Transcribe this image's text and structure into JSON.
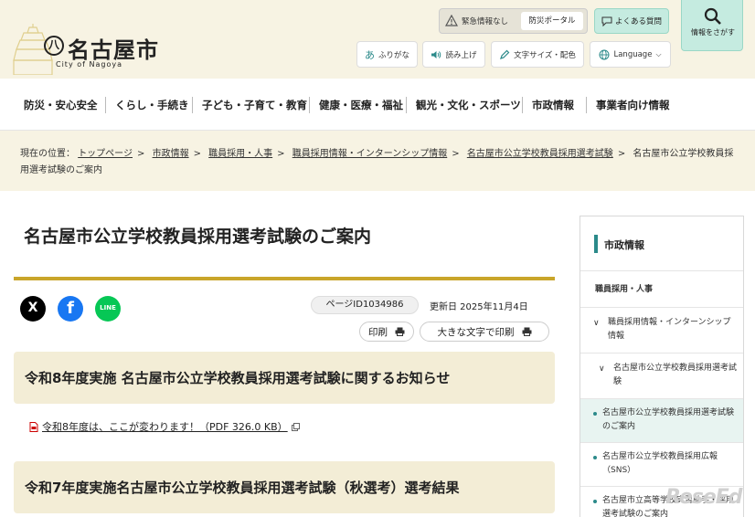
{
  "logo": {
    "title": "名古屋市",
    "subtitle": "City of Nagoya",
    "mark": "八"
  },
  "utility": {
    "emergency": "緊急情報なし",
    "portal": "防災ポータル",
    "faq": "よくある質問",
    "search": "情報をさがす",
    "furigana_icon": "あ",
    "furigana": "ふりがな",
    "readaloud": "読み上げ",
    "textsize": "文字サイズ・配色",
    "language": "Language"
  },
  "nav": [
    "防災・安心安全",
    "くらし・手続き",
    "子ども・子育て・教育",
    "健康・医療・福祉",
    "観光・文化・スポーツ",
    "市政情報",
    "事業者向け情報"
  ],
  "breadcrumb": {
    "label": "現在の位置：",
    "links": [
      "トップページ",
      "市政情報",
      "職員採用・人事",
      "職員採用情報・インターンシップ情報",
      "名古屋市公立学校教員採用選考試験"
    ],
    "current": "名古屋市公立学校教員採用選考試験のご案内",
    "separator": ">"
  },
  "page": {
    "title": "名古屋市公立学校教員採用選考試験のご案内",
    "page_id": "ページID1034986",
    "updated": "更新日 2025年11月4日",
    "print": "印刷",
    "print_large": "大きな文字で印刷"
  },
  "share": {
    "x_icon": "X",
    "fb_icon": "f",
    "line_icon": "LINE"
  },
  "sections": [
    {
      "title": "令和8年度実施 名古屋市公立学校教員採用選考試験に関するお知らせ"
    },
    {
      "title": "令和7年度実施名古屋市公立学校教員採用選考試験（秋選考）選考結果"
    }
  ],
  "pdf_link": "令和8年度は、ここが変わります！（PDF 326.0 KB）",
  "sidebar": {
    "title": "市政情報",
    "items": [
      "職員採用・人事",
      "職員採用情報・インターンシップ情報",
      "名古屋市公立学校教員採用選考試験",
      "名古屋市公立学校教員採用選考試験のご案内",
      "名古屋市公立学校教員採用広報（SNS）",
      "名古屋市立高等学校実習助手・採用選考試験のご案内"
    ]
  },
  "watermark": "ReseEd",
  "colors": {
    "header_bg": "#f7f3e3",
    "gold": "#c9a52a",
    "teal": "#2b8a8a",
    "mint": "#c5ebe0",
    "section_bg": "#f3edd6"
  }
}
